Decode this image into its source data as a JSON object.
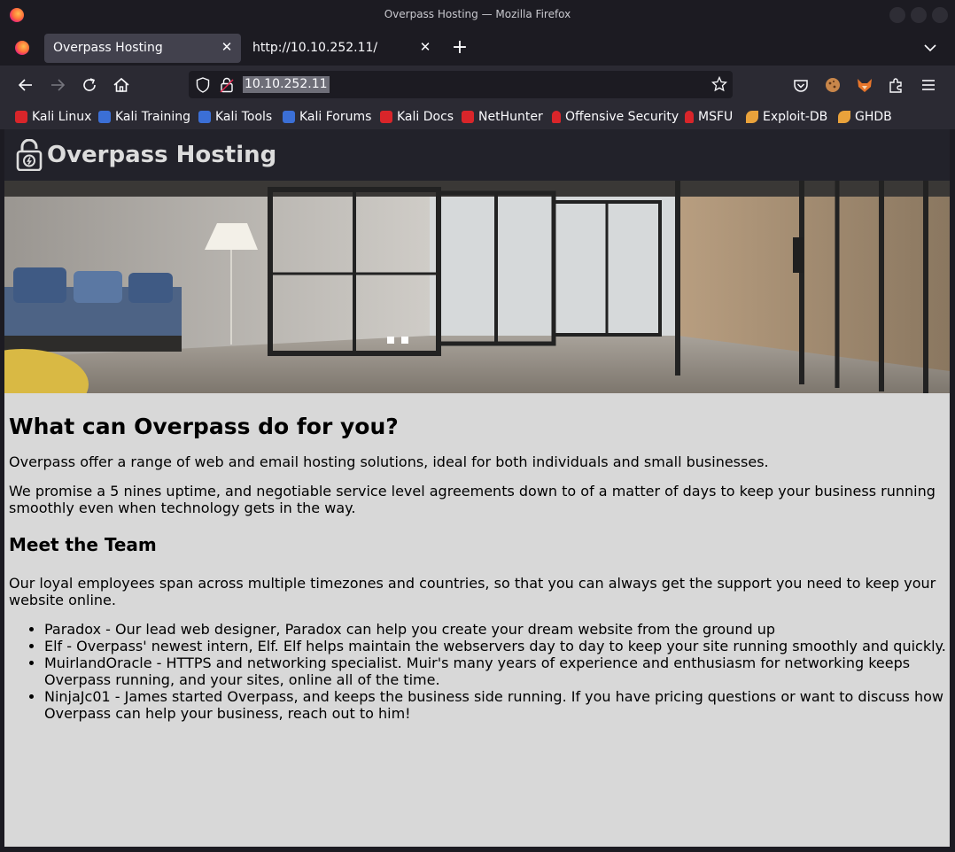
{
  "window": {
    "title": "Overpass Hosting — Mozilla Firefox"
  },
  "tabs": [
    {
      "label": "Overpass Hosting",
      "active": true
    },
    {
      "label": "http://10.10.252.11/",
      "active": false
    }
  ],
  "url": "10.10.252.11",
  "bookmarks": [
    {
      "label": "Kali Linux",
      "icon": "kali-dragon-icon",
      "color": "#e8e8e8"
    },
    {
      "label": "Kali Training",
      "icon": "kali-training-icon",
      "color": "#3b6fd6"
    },
    {
      "label": "Kali Tools",
      "icon": "kali-tools-icon",
      "color": "#3b6fd6"
    },
    {
      "label": "Kali Forums",
      "icon": "kali-forums-icon",
      "color": "#3b6fd6"
    },
    {
      "label": "Kali Docs",
      "icon": "kali-docs-icon",
      "color": "#d9252a"
    },
    {
      "label": "NetHunter",
      "icon": "nethunter-icon",
      "color": "#e8e8e8"
    },
    {
      "label": "Offensive Security",
      "icon": "offsec-icon",
      "color": "#d9252a"
    },
    {
      "label": "MSFU",
      "icon": "msfu-icon",
      "color": "#d9252a"
    },
    {
      "label": "Exploit-DB",
      "icon": "exploit-db-icon",
      "color": "#e9a23b"
    },
    {
      "label": "GHDB",
      "icon": "ghdb-icon",
      "color": "#e9a23b"
    }
  ],
  "site": {
    "brand": "Overpass Hosting",
    "heading": "What can Overpass do for you?",
    "intro": "Overpass offer a range of web and email hosting solutions, ideal for both individuals and small businesses.",
    "promise": "We promise a 5 nines uptime, and negotiable service level agreements down to of a matter of days to keep your business running smoothly even when technology gets in the way.",
    "team_heading": "Meet the Team",
    "team_intro": "Our loyal employees span across multiple timezones and countries, so that you can always get the support you need to keep your website online.",
    "team": [
      "Paradox - Our lead web designer, Paradox can help you create your dream website from the ground up",
      "Elf - Overpass' newest intern, Elf. Elf helps maintain the webservers day to day to keep your site running smoothly and quickly.",
      "MuirlandOracle - HTTPS and networking specialist. Muir's many years of experience and enthusiasm for networking keeps Overpass running, and your sites, online all of the time.",
      "NinjaJc01 - James started Overpass, and keeps the business side running. If you have pricing questions or want to discuss how Overpass can help your business, reach out to him!"
    ]
  },
  "colors": {
    "chrome_dark": "#1c1b22",
    "toolbar": "#2b2a33",
    "active_tab": "#42414d",
    "page_bg": "#d8d8d8",
    "site_header": "#22222a"
  }
}
